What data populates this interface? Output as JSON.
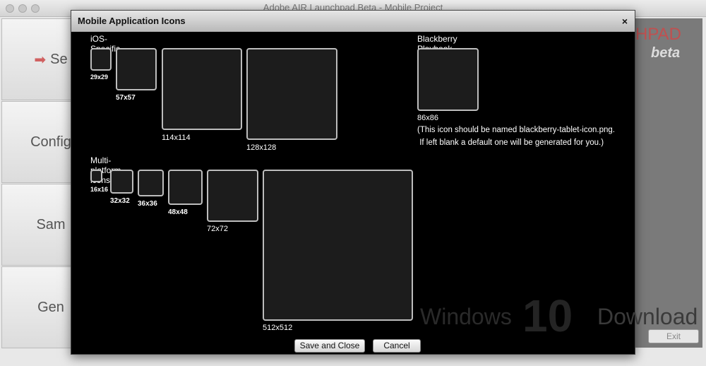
{
  "window": {
    "title": "Adobe AIR Launchpad Beta - Mobile Project"
  },
  "sidebar": [
    {
      "label": "Se"
    },
    {
      "label": "Config"
    },
    {
      "label": "Sam"
    },
    {
      "label": "Gen"
    }
  ],
  "logo": {
    "text": "HPAD",
    "sub": "beta"
  },
  "exit_label": "Exit",
  "dialog": {
    "title": "Mobile Application Icons",
    "close": "×",
    "ios_heading": "iOS-Specific icons",
    "ios": [
      "29x29",
      "57x57",
      "114x114",
      "128x128"
    ],
    "bb_heading": "Blackberry Playbook Launch Icon",
    "bb_size": "86x86",
    "bb_note1": "(This icon should be named blackberry-tablet-icon.png.",
    "bb_note2": " If left blank a default one will be generated for you.)",
    "multi_heading": "Multi-platform icons",
    "multi": [
      "16x16",
      "32x32",
      "36x36",
      "48x48",
      "72x72",
      "512x512"
    ],
    "save": "Save and Close",
    "cancel": "Cancel"
  },
  "watermark": {
    "left": "Windows",
    "mid": "10",
    "right": "Download"
  }
}
